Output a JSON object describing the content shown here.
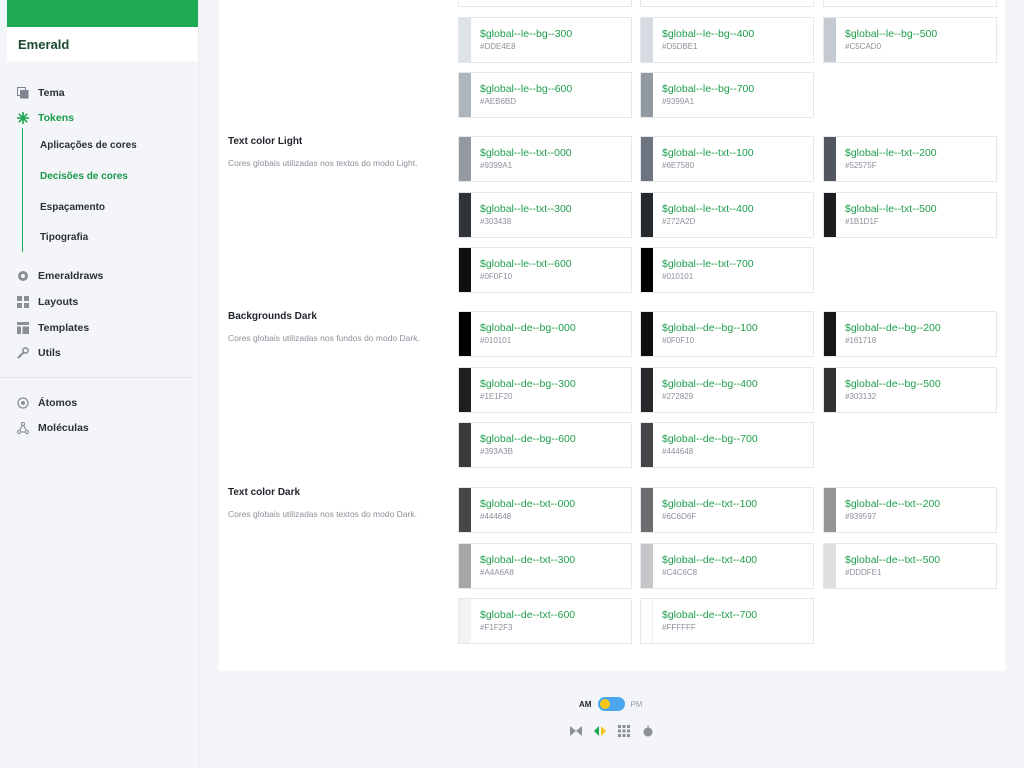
{
  "brand": {
    "name": "Emerald",
    "color": "#1eaa52"
  },
  "nav": [
    {
      "label": "Tema",
      "icon": "copy-icon"
    },
    {
      "label": "Tokens",
      "icon": "asterisk-icon",
      "active": true
    },
    {
      "label": "Emeraldraws",
      "icon": "gear-icon"
    },
    {
      "label": "Layouts",
      "icon": "grid-icon"
    },
    {
      "label": "Templates",
      "icon": "template-icon"
    },
    {
      "label": "Utils",
      "icon": "wrench-icon"
    },
    {
      "label": "Átomos",
      "icon": "atom-icon"
    },
    {
      "label": "Moléculas",
      "icon": "molecule-icon"
    }
  ],
  "tokens_sub": [
    {
      "label": "Aplicações de cores"
    },
    {
      "label": "Decisões de cores",
      "active": true
    },
    {
      "label": "Espaçamento"
    },
    {
      "label": "Tipografia"
    }
  ],
  "sections": [
    {
      "title": "",
      "description": "",
      "tokens": [
        {
          "name": "$global--le--bg--300",
          "hex": "#DDE4E8"
        },
        {
          "name": "$global--le--bg--400",
          "hex": "#D5DBE1"
        },
        {
          "name": "$global--le--bg--500",
          "hex": "#C5CAD0"
        },
        {
          "name": "$global--le--bg--600",
          "hex": "#AEB6BD"
        },
        {
          "name": "$global--le--bg--700",
          "hex": "#9399A1"
        }
      ]
    },
    {
      "title": "Text color Light",
      "description": "Cores globais utilizadas nos textos do modo Light.",
      "tokens": [
        {
          "name": "$global--le--txt--000",
          "hex": "#9399A1"
        },
        {
          "name": "$global--le--txt--100",
          "hex": "#6E7580"
        },
        {
          "name": "$global--le--txt--200",
          "hex": "#52575F"
        },
        {
          "name": "$global--le--txt--300",
          "hex": "#303438"
        },
        {
          "name": "$global--le--txt--400",
          "hex": "#272A2D"
        },
        {
          "name": "$global--le--txt--500",
          "hex": "#1B1D1F"
        },
        {
          "name": "$global--le--txt--600",
          "hex": "#0F0F10"
        },
        {
          "name": "$global--le--txt--700",
          "hex": "#010101"
        }
      ]
    },
    {
      "title": "Backgrounds Dark",
      "description": "Cores globais utilizadas nos fundos do modo Dark.",
      "tokens": [
        {
          "name": "$global--de--bg--000",
          "hex": "#010101"
        },
        {
          "name": "$global--de--bg--100",
          "hex": "#0F0F10"
        },
        {
          "name": "$global--de--bg--200",
          "hex": "#161718"
        },
        {
          "name": "$global--de--bg--300",
          "hex": "#1E1F20"
        },
        {
          "name": "$global--de--bg--400",
          "hex": "#272829"
        },
        {
          "name": "$global--de--bg--500",
          "hex": "#303132"
        },
        {
          "name": "$global--de--bg--600",
          "hex": "#393A3B"
        },
        {
          "name": "$global--de--bg--700",
          "hex": "#444648"
        }
      ]
    },
    {
      "title": "Text color Dark",
      "description": "Cores globais utilizadas nos textos do modo Dark.",
      "tokens": [
        {
          "name": "$global--de--txt--000",
          "hex": "#444648"
        },
        {
          "name": "$global--de--txt--100",
          "hex": "#6C6D6F"
        },
        {
          "name": "$global--de--txt--200",
          "hex": "#939597"
        },
        {
          "name": "$global--de--txt--300",
          "hex": "#A4A6A8"
        },
        {
          "name": "$global--de--txt--400",
          "hex": "#C4C6C8"
        },
        {
          "name": "$global--de--txt--500",
          "hex": "#DDDFE1"
        },
        {
          "name": "$global--de--txt--600",
          "hex": "#F1F2F3"
        },
        {
          "name": "$global--de--txt--700",
          "hex": "#FFFFFF"
        }
      ]
    }
  ],
  "footer": {
    "am_label": "AM",
    "pm_label": "PM",
    "icons": [
      "bowtie-icon",
      "code-icon",
      "grid-dots-icon",
      "apple-icon"
    ]
  }
}
